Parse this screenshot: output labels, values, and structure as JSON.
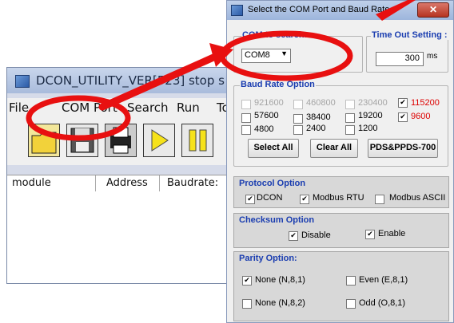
{
  "bg_window": {
    "title": "DCON_UTILITY_VER[523] stop s",
    "menu": [
      "File",
      "COM Port",
      "Search",
      "Run",
      "To"
    ],
    "toolbar_icons": [
      "open-folder-icon",
      "save-disk-icon",
      "printer-icon",
      "play-icon",
      "pause-icon"
    ],
    "columns": [
      "module",
      "Address",
      "Baudrate:"
    ]
  },
  "dialog": {
    "title": "Select the COM Port and Baud Rate",
    "com_group": {
      "legend": "COM to search:",
      "value": "COM8"
    },
    "timeout_group": {
      "legend": "Time Out Setting :",
      "value": "300",
      "unit": "ms"
    },
    "baud_group": {
      "legend": "Baud Rate Option",
      "options": [
        {
          "label": "921600",
          "checked": false,
          "enabled": false
        },
        {
          "label": "460800",
          "checked": false,
          "enabled": false
        },
        {
          "label": "230400",
          "checked": false,
          "enabled": false
        },
        {
          "label": "115200",
          "checked": true,
          "enabled": true
        },
        {
          "label": "57600",
          "checked": false,
          "enabled": true
        },
        {
          "label": "38400",
          "checked": false,
          "enabled": true
        },
        {
          "label": "19200",
          "checked": false,
          "enabled": true
        },
        {
          "label": "9600",
          "checked": true,
          "enabled": true
        },
        {
          "label": "4800",
          "checked": false,
          "enabled": true
        },
        {
          "label": "2400",
          "checked": false,
          "enabled": true
        },
        {
          "label": "1200",
          "checked": false,
          "enabled": true
        }
      ],
      "buttons": {
        "select_all": "Select All",
        "clear_all": "Clear All",
        "pds": "PDS&PPDS-700"
      }
    },
    "protocol": {
      "title": "Protocol Option",
      "options": [
        {
          "label": "DCON",
          "checked": true
        },
        {
          "label": "Modbus RTU",
          "checked": true
        },
        {
          "label": "Modbus ASCII",
          "checked": false
        }
      ]
    },
    "checksum": {
      "title": "Checksum  Option",
      "options": [
        {
          "label": "Disable",
          "checked": true
        },
        {
          "label": "Enable",
          "checked": true
        }
      ]
    },
    "parity": {
      "title": "Parity Option:",
      "options": [
        {
          "label": "None  (N,8,1)",
          "checked": true
        },
        {
          "label": "Even  (E,8,1)",
          "checked": false
        },
        {
          "label": "None (N,8,2)",
          "checked": false
        },
        {
          "label": "Odd  (O,8,1)",
          "checked": false
        }
      ]
    }
  },
  "colors": {
    "annotation": "#e81010",
    "group_title": "#1a3db0",
    "checked_red_label": "#dd0000"
  }
}
